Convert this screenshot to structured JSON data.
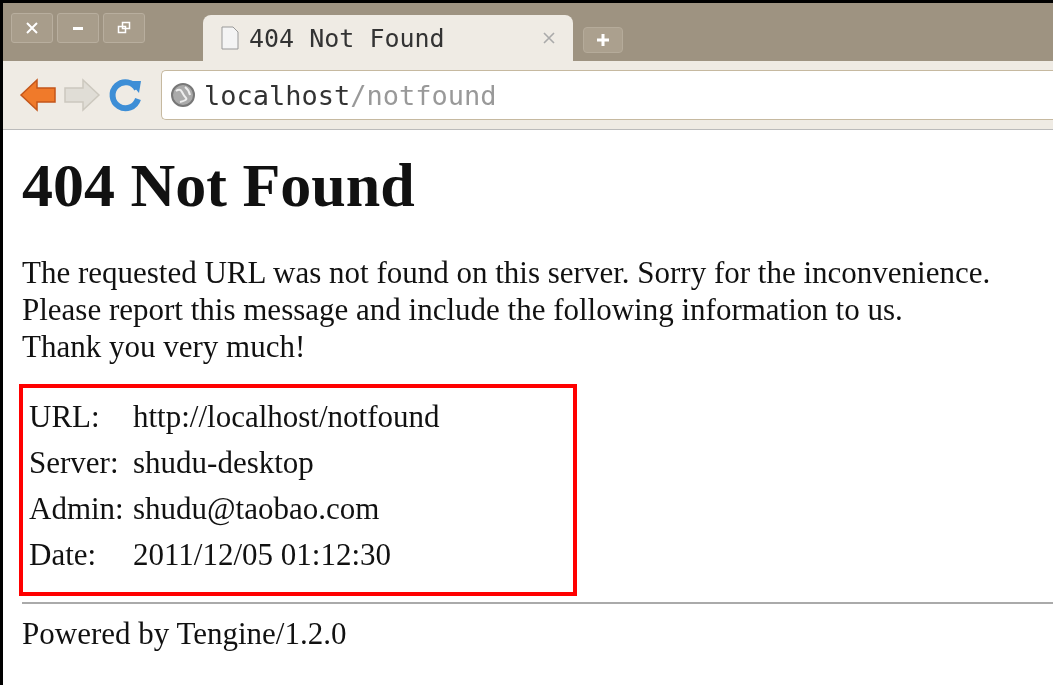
{
  "window": {
    "controls": [
      {
        "kind": "close"
      },
      {
        "kind": "minimize"
      },
      {
        "kind": "restore"
      }
    ]
  },
  "tabs": [
    {
      "title": "404 Not Found",
      "selected": true
    }
  ],
  "toolbar": {
    "address_host": "localhost",
    "address_path": "/notfound",
    "forward_disabled": true
  },
  "page": {
    "heading": "404 Not Found",
    "paragraph_lines": [
      "The requested URL was not found on this server. Sorry for the inconvenience.",
      "Please report this message and include the following information to us.",
      "Thank you very much!"
    ],
    "info": [
      {
        "label": "URL:",
        "value": "http://localhost/notfound"
      },
      {
        "label": "Server:",
        "value": "shudu-desktop"
      },
      {
        "label": "Admin:",
        "value": "shudu@taobao.com"
      },
      {
        "label": "Date:",
        "value": "2011/12/05 01:12:30"
      }
    ],
    "footer": "Powered by Tengine/1.2.0"
  }
}
